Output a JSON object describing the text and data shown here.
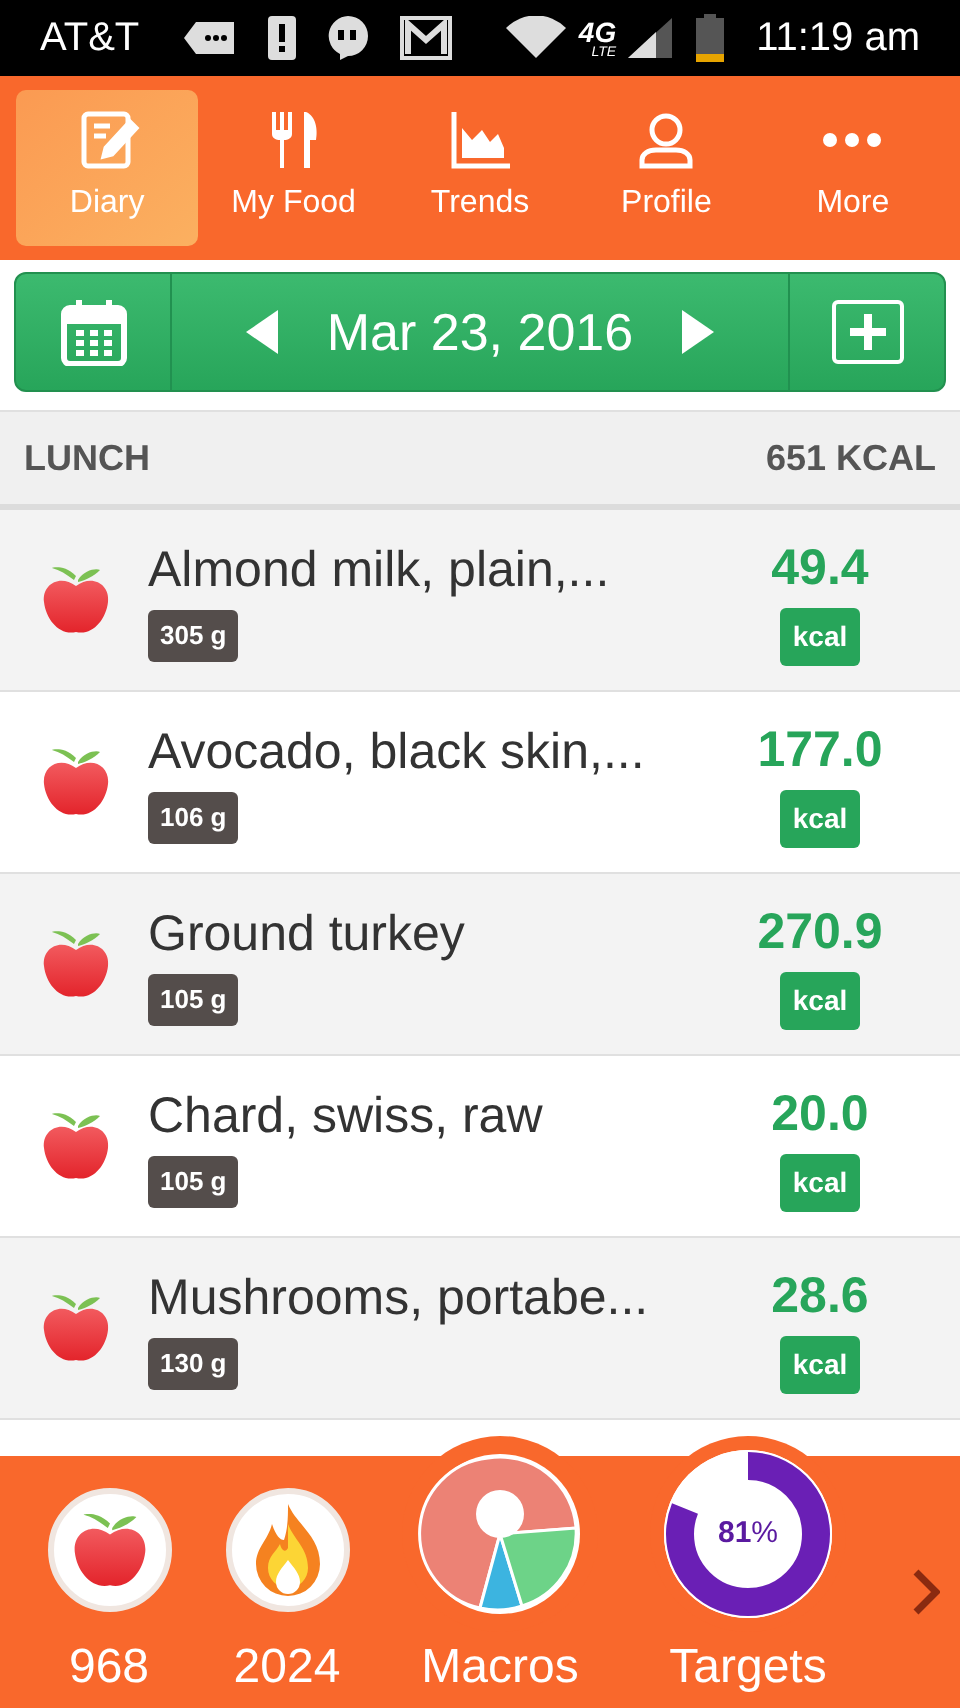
{
  "status_bar": {
    "carrier": "AT&T",
    "time": "11:19 am",
    "network": "4G",
    "network_sub": "LTE"
  },
  "tabs": [
    {
      "label": "Diary",
      "kind": "diary",
      "selected": true
    },
    {
      "label": "My Food",
      "kind": "food",
      "selected": false
    },
    {
      "label": "Trends",
      "kind": "trends",
      "selected": false
    },
    {
      "label": "Profile",
      "kind": "profile",
      "selected": false
    },
    {
      "label": "More",
      "kind": "more",
      "selected": false
    }
  ],
  "date_bar": {
    "date": "Mar 23, 2016"
  },
  "meal": {
    "name": "LUNCH",
    "total": "651 KCAL"
  },
  "foods": [
    {
      "name": "Almond milk, plain,...",
      "amount": "305 g",
      "calories": "49.4",
      "unit": "kcal"
    },
    {
      "name": "Avocado, black skin,...",
      "amount": "106 g",
      "calories": "177.0",
      "unit": "kcal"
    },
    {
      "name": "Ground turkey",
      "amount": "105 g",
      "calories": "270.9",
      "unit": "kcal"
    },
    {
      "name": "Chard, swiss, raw",
      "amount": "105 g",
      "calories": "20.0",
      "unit": "kcal"
    },
    {
      "name": "Mushrooms, portabe...",
      "amount": "130 g",
      "calories": "28.6",
      "unit": "kcal"
    }
  ],
  "summary": [
    {
      "kind": "eaten",
      "label": "968"
    },
    {
      "kind": "burned",
      "label": "2024"
    },
    {
      "kind": "macros",
      "label": "Macros"
    },
    {
      "kind": "targets",
      "label": "Targets",
      "value": "81",
      "unit": "%",
      "level": 0.81
    }
  ]
}
